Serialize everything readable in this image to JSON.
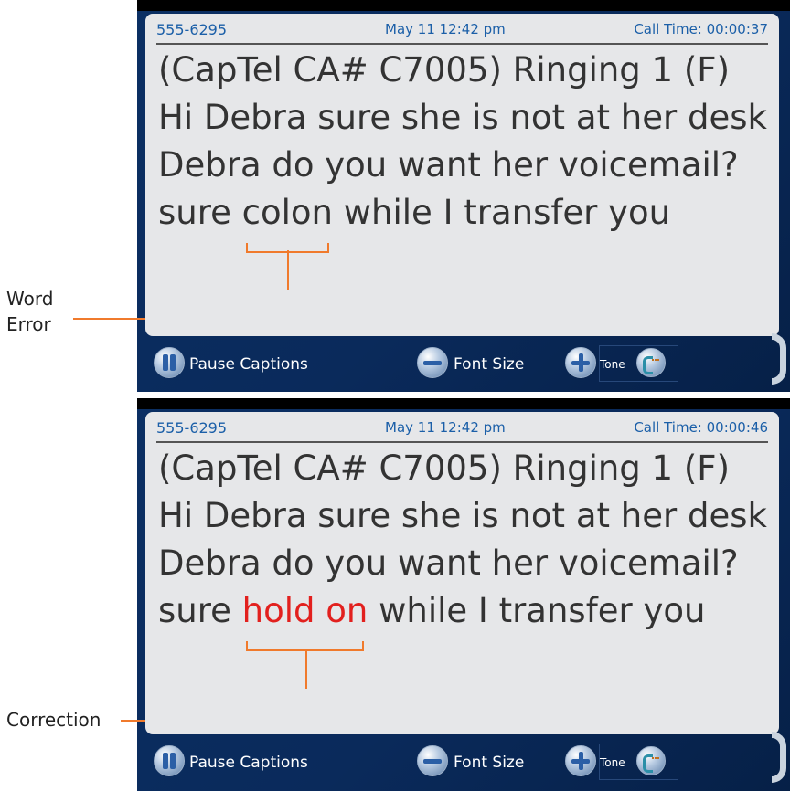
{
  "screens": [
    {
      "header": {
        "phone": "555-6295",
        "datetime": "May  11 12:42  pm",
        "call_time": "Call Time:  00:00:37"
      },
      "caption": {
        "before": " (CapTel CA# C7005) Ringing 1 (F) Hi Debra sure she is not at her desk Debra do you want her voicemail?  sure ",
        "highlight": "colon",
        "after": " while I transfer you",
        "highlight_type": "error"
      },
      "toolbar": {
        "pause": "Pause Captions",
        "font_size": "Font Size",
        "tone": "Tone"
      }
    },
    {
      "header": {
        "phone": "555-6295",
        "datetime": "May  11 12:42  pm",
        "call_time": "Call Time:  00:00:46"
      },
      "caption": {
        "before": " (CapTel CA# C7005) Ringing 1 (F) Hi Debra sure she is not at her desk Debra do you want her voicemail?  sure ",
        "highlight": "hold on",
        "after": " while I transfer you",
        "highlight_type": "correction"
      },
      "toolbar": {
        "pause": "Pause Captions",
        "font_size": "Font Size",
        "tone": "Tone"
      }
    }
  ],
  "callouts": {
    "top": "Word\nError",
    "bottom": "Correction"
  },
  "colors": {
    "accent": "#f07a2c",
    "correction_text": "#e2201e",
    "header_text": "#1b5fa8"
  }
}
